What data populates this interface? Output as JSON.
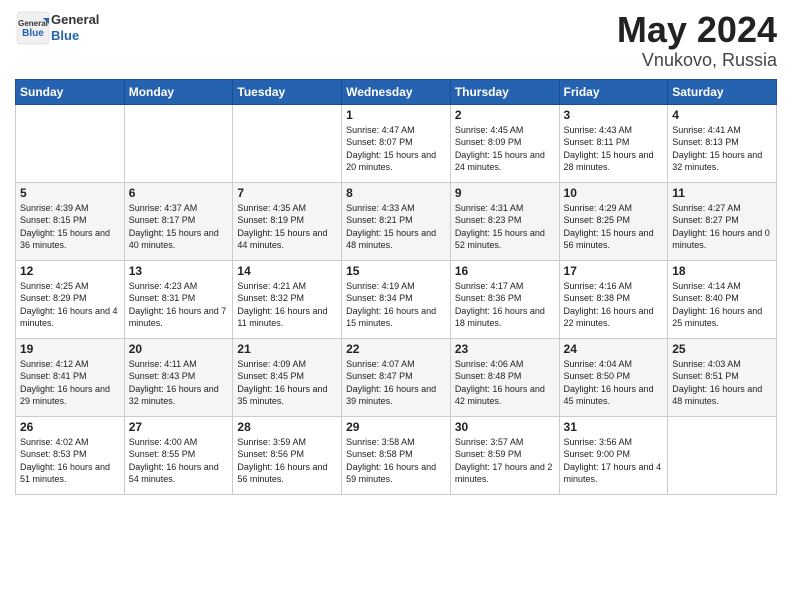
{
  "header": {
    "logo_general": "General",
    "logo_blue": "Blue",
    "title": "May 2024",
    "location": "Vnukovo, Russia"
  },
  "days_of_week": [
    "Sunday",
    "Monday",
    "Tuesday",
    "Wednesday",
    "Thursday",
    "Friday",
    "Saturday"
  ],
  "weeks": [
    [
      {
        "day": "",
        "sunrise": "",
        "sunset": "",
        "daylight": ""
      },
      {
        "day": "",
        "sunrise": "",
        "sunset": "",
        "daylight": ""
      },
      {
        "day": "",
        "sunrise": "",
        "sunset": "",
        "daylight": ""
      },
      {
        "day": "1",
        "sunrise": "Sunrise: 4:47 AM",
        "sunset": "Sunset: 8:07 PM",
        "daylight": "Daylight: 15 hours and 20 minutes."
      },
      {
        "day": "2",
        "sunrise": "Sunrise: 4:45 AM",
        "sunset": "Sunset: 8:09 PM",
        "daylight": "Daylight: 15 hours and 24 minutes."
      },
      {
        "day": "3",
        "sunrise": "Sunrise: 4:43 AM",
        "sunset": "Sunset: 8:11 PM",
        "daylight": "Daylight: 15 hours and 28 minutes."
      },
      {
        "day": "4",
        "sunrise": "Sunrise: 4:41 AM",
        "sunset": "Sunset: 8:13 PM",
        "daylight": "Daylight: 15 hours and 32 minutes."
      }
    ],
    [
      {
        "day": "5",
        "sunrise": "Sunrise: 4:39 AM",
        "sunset": "Sunset: 8:15 PM",
        "daylight": "Daylight: 15 hours and 36 minutes."
      },
      {
        "day": "6",
        "sunrise": "Sunrise: 4:37 AM",
        "sunset": "Sunset: 8:17 PM",
        "daylight": "Daylight: 15 hours and 40 minutes."
      },
      {
        "day": "7",
        "sunrise": "Sunrise: 4:35 AM",
        "sunset": "Sunset: 8:19 PM",
        "daylight": "Daylight: 15 hours and 44 minutes."
      },
      {
        "day": "8",
        "sunrise": "Sunrise: 4:33 AM",
        "sunset": "Sunset: 8:21 PM",
        "daylight": "Daylight: 15 hours and 48 minutes."
      },
      {
        "day": "9",
        "sunrise": "Sunrise: 4:31 AM",
        "sunset": "Sunset: 8:23 PM",
        "daylight": "Daylight: 15 hours and 52 minutes."
      },
      {
        "day": "10",
        "sunrise": "Sunrise: 4:29 AM",
        "sunset": "Sunset: 8:25 PM",
        "daylight": "Daylight: 15 hours and 56 minutes."
      },
      {
        "day": "11",
        "sunrise": "Sunrise: 4:27 AM",
        "sunset": "Sunset: 8:27 PM",
        "daylight": "Daylight: 16 hours and 0 minutes."
      }
    ],
    [
      {
        "day": "12",
        "sunrise": "Sunrise: 4:25 AM",
        "sunset": "Sunset: 8:29 PM",
        "daylight": "Daylight: 16 hours and 4 minutes."
      },
      {
        "day": "13",
        "sunrise": "Sunrise: 4:23 AM",
        "sunset": "Sunset: 8:31 PM",
        "daylight": "Daylight: 16 hours and 7 minutes."
      },
      {
        "day": "14",
        "sunrise": "Sunrise: 4:21 AM",
        "sunset": "Sunset: 8:32 PM",
        "daylight": "Daylight: 16 hours and 11 minutes."
      },
      {
        "day": "15",
        "sunrise": "Sunrise: 4:19 AM",
        "sunset": "Sunset: 8:34 PM",
        "daylight": "Daylight: 16 hours and 15 minutes."
      },
      {
        "day": "16",
        "sunrise": "Sunrise: 4:17 AM",
        "sunset": "Sunset: 8:36 PM",
        "daylight": "Daylight: 16 hours and 18 minutes."
      },
      {
        "day": "17",
        "sunrise": "Sunrise: 4:16 AM",
        "sunset": "Sunset: 8:38 PM",
        "daylight": "Daylight: 16 hours and 22 minutes."
      },
      {
        "day": "18",
        "sunrise": "Sunrise: 4:14 AM",
        "sunset": "Sunset: 8:40 PM",
        "daylight": "Daylight: 16 hours and 25 minutes."
      }
    ],
    [
      {
        "day": "19",
        "sunrise": "Sunrise: 4:12 AM",
        "sunset": "Sunset: 8:41 PM",
        "daylight": "Daylight: 16 hours and 29 minutes."
      },
      {
        "day": "20",
        "sunrise": "Sunrise: 4:11 AM",
        "sunset": "Sunset: 8:43 PM",
        "daylight": "Daylight: 16 hours and 32 minutes."
      },
      {
        "day": "21",
        "sunrise": "Sunrise: 4:09 AM",
        "sunset": "Sunset: 8:45 PM",
        "daylight": "Daylight: 16 hours and 35 minutes."
      },
      {
        "day": "22",
        "sunrise": "Sunrise: 4:07 AM",
        "sunset": "Sunset: 8:47 PM",
        "daylight": "Daylight: 16 hours and 39 minutes."
      },
      {
        "day": "23",
        "sunrise": "Sunrise: 4:06 AM",
        "sunset": "Sunset: 8:48 PM",
        "daylight": "Daylight: 16 hours and 42 minutes."
      },
      {
        "day": "24",
        "sunrise": "Sunrise: 4:04 AM",
        "sunset": "Sunset: 8:50 PM",
        "daylight": "Daylight: 16 hours and 45 minutes."
      },
      {
        "day": "25",
        "sunrise": "Sunrise: 4:03 AM",
        "sunset": "Sunset: 8:51 PM",
        "daylight": "Daylight: 16 hours and 48 minutes."
      }
    ],
    [
      {
        "day": "26",
        "sunrise": "Sunrise: 4:02 AM",
        "sunset": "Sunset: 8:53 PM",
        "daylight": "Daylight: 16 hours and 51 minutes."
      },
      {
        "day": "27",
        "sunrise": "Sunrise: 4:00 AM",
        "sunset": "Sunset: 8:55 PM",
        "daylight": "Daylight: 16 hours and 54 minutes."
      },
      {
        "day": "28",
        "sunrise": "Sunrise: 3:59 AM",
        "sunset": "Sunset: 8:56 PM",
        "daylight": "Daylight: 16 hours and 56 minutes."
      },
      {
        "day": "29",
        "sunrise": "Sunrise: 3:58 AM",
        "sunset": "Sunset: 8:58 PM",
        "daylight": "Daylight: 16 hours and 59 minutes."
      },
      {
        "day": "30",
        "sunrise": "Sunrise: 3:57 AM",
        "sunset": "Sunset: 8:59 PM",
        "daylight": "Daylight: 17 hours and 2 minutes."
      },
      {
        "day": "31",
        "sunrise": "Sunrise: 3:56 AM",
        "sunset": "Sunset: 9:00 PM",
        "daylight": "Daylight: 17 hours and 4 minutes."
      },
      {
        "day": "",
        "sunrise": "",
        "sunset": "",
        "daylight": ""
      }
    ]
  ]
}
